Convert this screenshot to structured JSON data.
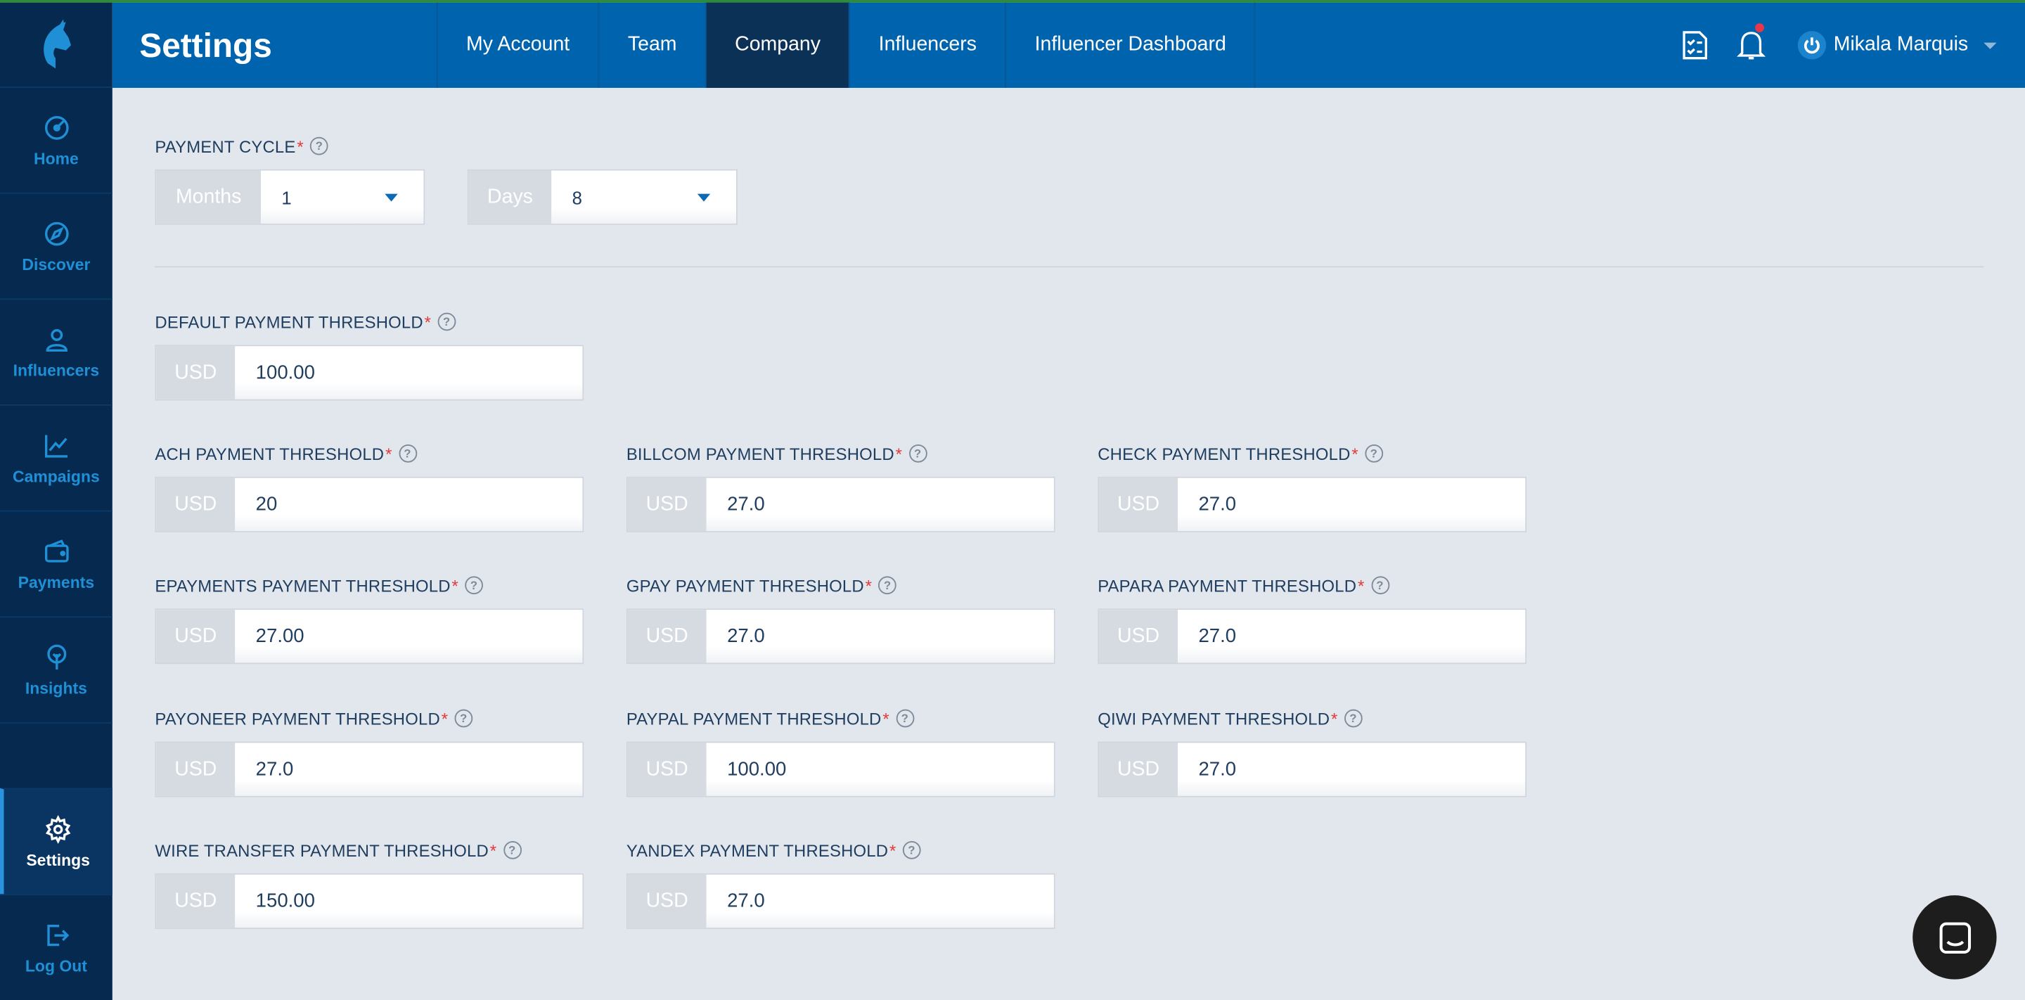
{
  "header": {
    "title": "Settings",
    "tabs": [
      {
        "label": "My Account"
      },
      {
        "label": "Team"
      },
      {
        "label": "Company"
      },
      {
        "label": "Influencers"
      },
      {
        "label": "Influencer Dashboard"
      }
    ],
    "active_tab": "Company",
    "user_name": "Mikala Marquis"
  },
  "sidebar": {
    "items": [
      {
        "label": "Home",
        "icon": "home-icon"
      },
      {
        "label": "Discover",
        "icon": "discover-icon"
      },
      {
        "label": "Influencers",
        "icon": "user-icon"
      },
      {
        "label": "Campaigns",
        "icon": "campaigns-icon"
      },
      {
        "label": "Payments",
        "icon": "wallet-icon"
      },
      {
        "label": "Insights",
        "icon": "insights-icon"
      }
    ],
    "bottom_items": [
      {
        "label": "Settings",
        "icon": "gear-icon"
      },
      {
        "label": "Log Out",
        "icon": "logout-icon"
      }
    ]
  },
  "payment_cycle": {
    "label": "PAYMENT CYCLE",
    "months_addon": "Months",
    "months_value": "1",
    "days_addon": "Days",
    "days_value": "8"
  },
  "default_threshold": {
    "label": "DEFAULT PAYMENT THRESHOLD",
    "currency": "USD",
    "value": "100.00"
  },
  "thresholds": [
    {
      "label": "ACH PAYMENT THRESHOLD",
      "currency": "USD",
      "value": "20"
    },
    {
      "label": "BILLCOM PAYMENT THRESHOLD",
      "currency": "USD",
      "value": "27.0"
    },
    {
      "label": "CHECK PAYMENT THRESHOLD",
      "currency": "USD",
      "value": "27.0"
    },
    {
      "label": "EPAYMENTS PAYMENT THRESHOLD",
      "currency": "USD",
      "value": "27.00"
    },
    {
      "label": "GPAY PAYMENT THRESHOLD",
      "currency": "USD",
      "value": "27.0"
    },
    {
      "label": "PAPARA PAYMENT THRESHOLD",
      "currency": "USD",
      "value": "27.0"
    },
    {
      "label": "PAYONEER PAYMENT THRESHOLD",
      "currency": "USD",
      "value": "27.0"
    },
    {
      "label": "PAYPAL PAYMENT THRESHOLD",
      "currency": "USD",
      "value": "100.00"
    },
    {
      "label": "QIWI PAYMENT THRESHOLD",
      "currency": "USD",
      "value": "27.0"
    },
    {
      "label": "WIRE TRANSFER PAYMENT THRESHOLD",
      "currency": "USD",
      "value": "150.00"
    },
    {
      "label": "YANDEX PAYMENT THRESHOLD",
      "currency": "USD",
      "value": "27.0"
    }
  ],
  "colors": {
    "header_bg": "#0063ae",
    "sidebar_bg": "#062a4f",
    "active_tab_bg": "#0c3157",
    "content_bg": "#e2e6ed",
    "required_mark": "#e23a3a"
  }
}
